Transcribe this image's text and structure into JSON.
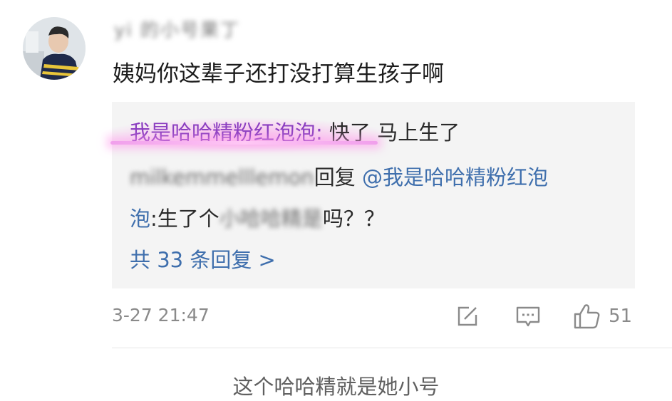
{
  "comment": {
    "username": "yi 的小号果丁",
    "text": "姨妈你这辈子还打没打算生孩子啊"
  },
  "replies": {
    "reply1": {
      "author": "我是哈哈精粉红泡泡",
      "separator": ": ",
      "text": "快了  马上生了"
    },
    "reply2": {
      "author_blurred": "milkemmelllemon",
      "verb": "回复",
      "mention_line1": "@我是哈哈精粉红泡",
      "mention_line2": "泡",
      "text_prefix": ":生了个",
      "text_blurred": "小哈哈精是",
      "text_suffix": "吗？？"
    },
    "more": "共 33 条回复 >"
  },
  "meta": {
    "timestamp": "3-27 21:47",
    "like_count": "51"
  },
  "caption": "这个哈哈精就是她小号",
  "colors": {
    "link": "#3f6fad",
    "highlight": "#8a3ec0",
    "reply_bg": "#f4f4f4"
  },
  "icons": {
    "share": "share-edit-icon",
    "comment": "comment-bubble-icon",
    "like": "thumbs-up-icon"
  }
}
